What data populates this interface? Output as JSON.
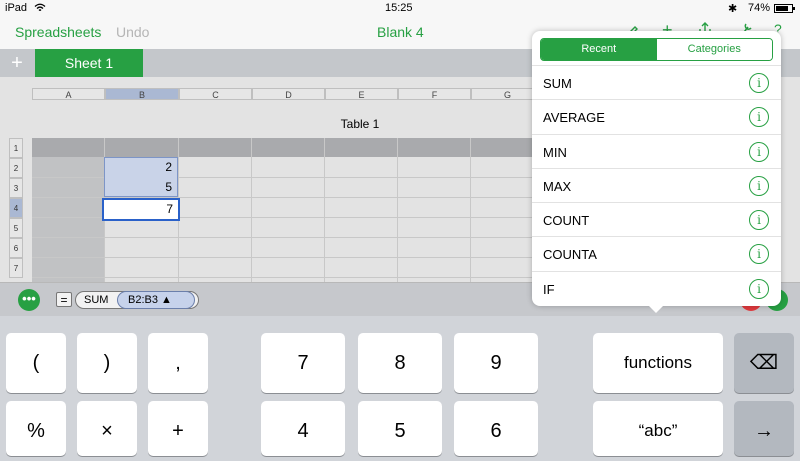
{
  "status": {
    "device": "iPad",
    "time": "15:25",
    "battery": "74%"
  },
  "nav": {
    "back_label": "Spreadsheets",
    "undo_label": "Undo",
    "title": "Blank 4"
  },
  "sheet_tab": {
    "label": "Sheet 1"
  },
  "grid": {
    "columns": [
      "A",
      "B",
      "C",
      "D",
      "E",
      "F",
      "G"
    ],
    "rows": [
      "1",
      "2",
      "3",
      "4",
      "5",
      "6",
      "7"
    ],
    "table_title": "Table 1",
    "values": {
      "B2": "2",
      "B3": "5",
      "B4": "7"
    }
  },
  "formula": {
    "function": "SUM",
    "range": "B2:B3 ▲"
  },
  "popover": {
    "tabs": {
      "recent": "Recent",
      "categories": "Categories"
    },
    "functions": [
      "SUM",
      "AVERAGE",
      "MIN",
      "MAX",
      "COUNT",
      "COUNTA",
      "IF"
    ],
    "info_glyph": "i"
  },
  "keyboard": {
    "row1": [
      "(",
      ")",
      ",",
      "7",
      "8",
      "9",
      "functions",
      "⌫"
    ],
    "row2": [
      "%",
      "×",
      "+",
      "4",
      "5",
      "6",
      "“abc”",
      "→"
    ]
  },
  "colors": {
    "accent": "#27a043",
    "selection": "#2a61c9"
  }
}
